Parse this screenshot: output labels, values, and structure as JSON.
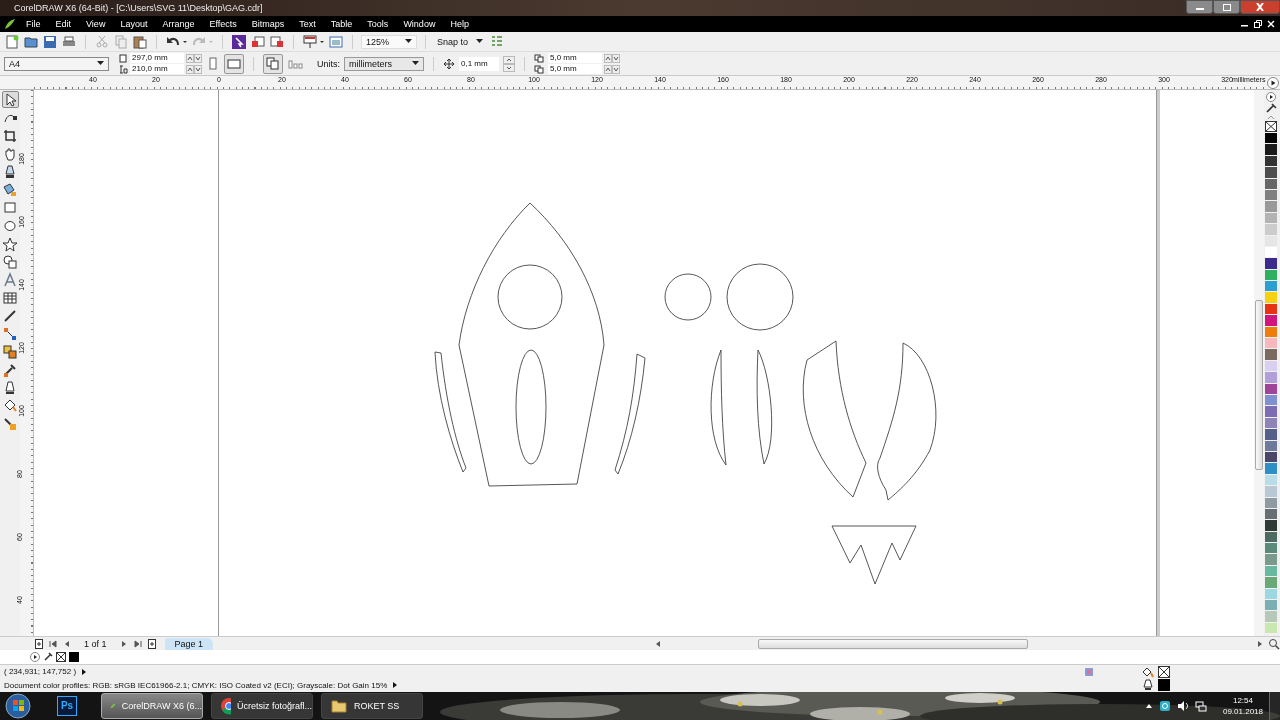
{
  "window": {
    "title": "CorelDRAW X6 (64-Bit) - [C:\\Users\\SVG 11\\Desktop\\GAG.cdr]"
  },
  "menu": [
    "File",
    "Edit",
    "View",
    "Layout",
    "Arrange",
    "Effects",
    "Bitmaps",
    "Text",
    "Table",
    "Tools",
    "Window",
    "Help"
  ],
  "standard_toolbar": {
    "zoom": "125%",
    "snap": "Snap to"
  },
  "property_bar": {
    "page_size": "A4",
    "width": "297,0 mm",
    "height": "210,0 mm",
    "units_label": "Units:",
    "units": "millimeters",
    "nudge": "0,1 mm",
    "duplicate_x": "5,0 mm",
    "duplicate_y": "5,0 mm"
  },
  "ruler": {
    "h_labels": [
      "40",
      "20",
      "0",
      "20",
      "40",
      "60",
      "80",
      "100",
      "120",
      "140",
      "160",
      "180",
      "200",
      "220",
      "240",
      "260",
      "280",
      "300",
      "320"
    ],
    "unit": "millimeters",
    "v_labels": [
      "180",
      "160",
      "140",
      "120",
      "100",
      "80",
      "60",
      "40"
    ]
  },
  "tools": [
    {
      "kind": "pick",
      "selected": true
    },
    {
      "kind": "shape",
      "selected": false
    },
    {
      "kind": "crop",
      "selected": false
    },
    {
      "kind": "zoom",
      "selected": false
    },
    {
      "kind": "freehand",
      "selected": false
    },
    {
      "kind": "smartfill",
      "selected": false
    },
    {
      "kind": "rectangle",
      "selected": false
    },
    {
      "kind": "ellipse",
      "selected": false
    },
    {
      "kind": "polygon",
      "selected": false
    },
    {
      "kind": "basicshapes",
      "selected": false
    },
    {
      "kind": "text",
      "selected": false
    },
    {
      "kind": "table",
      "selected": false
    },
    {
      "kind": "dimension",
      "selected": false
    },
    {
      "kind": "connector",
      "selected": false
    },
    {
      "kind": "blend",
      "selected": false
    },
    {
      "kind": "eyedropper",
      "selected": false
    },
    {
      "kind": "outline",
      "selected": false
    },
    {
      "kind": "fill",
      "selected": false
    },
    {
      "kind": "interactivefill",
      "selected": false
    }
  ],
  "palette": [
    {
      "color": "#000000"
    },
    {
      "color": "#1a1a1a"
    },
    {
      "color": "#333333"
    },
    {
      "color": "#4d4d4d"
    },
    {
      "color": "#666666"
    },
    {
      "color": "#808080"
    },
    {
      "color": "#999999"
    },
    {
      "color": "#b3b3b3"
    },
    {
      "color": "#cccccc"
    },
    {
      "color": "#e6e6e6"
    },
    {
      "color": "#ffffff"
    },
    {
      "color": "#3d2a8f"
    },
    {
      "color": "#2eb05e"
    },
    {
      "color": "#2a9fd0"
    },
    {
      "color": "#f5d10f"
    },
    {
      "color": "#e63312"
    },
    {
      "color": "#d4147e"
    },
    {
      "color": "#f07d0a"
    },
    {
      "color": "#f7b7be"
    },
    {
      "color": "#7a6a60"
    },
    {
      "color": "#d9d0ef"
    },
    {
      "color": "#b09fd8"
    },
    {
      "color": "#a0449a"
    },
    {
      "color": "#7f8fcf"
    },
    {
      "color": "#7c6cb4"
    },
    {
      "color": "#8f84b8"
    },
    {
      "color": "#55608a"
    },
    {
      "color": "#6e7a9a"
    },
    {
      "color": "#4a4668"
    },
    {
      "color": "#2d8fc4"
    },
    {
      "color": "#b9dde8"
    },
    {
      "color": "#b8c8d4"
    },
    {
      "color": "#909aa2"
    },
    {
      "color": "#666e72"
    },
    {
      "color": "#2e3a36"
    },
    {
      "color": "#4e6a62"
    },
    {
      "color": "#5c8a7a"
    },
    {
      "color": "#7a9a8c"
    },
    {
      "color": "#6ab8a0"
    },
    {
      "color": "#6aa878"
    },
    {
      "color": "#9cd8e2"
    },
    {
      "color": "#7ab0b4"
    },
    {
      "color": "#b8c8b8"
    },
    {
      "color": "#c8e8b0"
    }
  ],
  "page_nav": {
    "count": "1 of 1",
    "tabs": [
      {
        "label": "Page 1",
        "selected": true
      }
    ]
  },
  "status": {
    "coords": "( 234,931; 147,752 )",
    "profiles": "Document color profiles: RGB: sRGB IEC61966-2.1; CMYK: ISO Coated v2 (ECI); Grayscale: Dot Gain 15%"
  },
  "taskbar": {
    "pinned": [
      {
        "label": "Ps"
      }
    ],
    "tasks": [
      {
        "label": "CorelDRAW X6 (6...",
        "kind": "corel",
        "selected": true
      },
      {
        "label": "Ücretsiz fotoğrafl...",
        "kind": "chrome",
        "selected": false
      },
      {
        "label": "ROKET SS",
        "kind": "folder",
        "selected": false
      }
    ],
    "time": "12:54",
    "date": "09.01.2018"
  }
}
